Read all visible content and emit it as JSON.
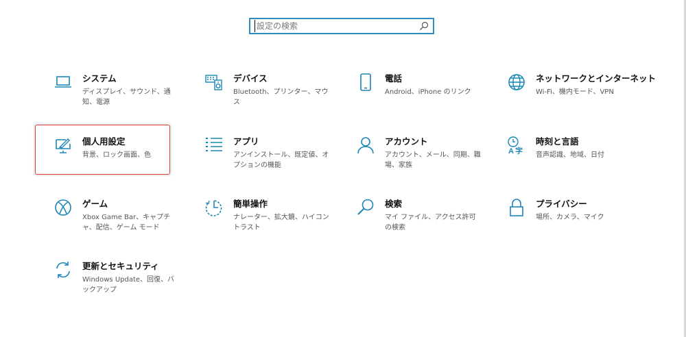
{
  "search": {
    "placeholder": "設定の検索"
  },
  "colors": {
    "accent": "#1a86b8",
    "highlight": "#e0413a"
  },
  "tiles": [
    {
      "title": "システム",
      "desc": "ディスプレイ、サウンド、通知、電源",
      "icon": "laptop-icon"
    },
    {
      "title": "デバイス",
      "desc": "Bluetooth、プリンター、マウス",
      "icon": "keyboard-speaker-icon"
    },
    {
      "title": "電話",
      "desc": "Android、iPhone のリンク",
      "icon": "phone-icon"
    },
    {
      "title": "ネットワークとインターネット",
      "desc": "Wi-Fi、機内モード、VPN",
      "icon": "globe-icon"
    },
    {
      "title": "個人用設定",
      "desc": "背景、ロック画面、色",
      "icon": "paint-monitor-icon"
    },
    {
      "title": "アプリ",
      "desc": "アンインストール、既定値、オプションの機能",
      "icon": "app-list-icon"
    },
    {
      "title": "アカウント",
      "desc": "アカウント、メール、同期、職場、家族",
      "icon": "person-icon"
    },
    {
      "title": "時刻と言語",
      "desc": "音声認識、地域、日付",
      "icon": "time-language-icon"
    },
    {
      "title": "ゲーム",
      "desc": "Xbox Game Bar、キャプチャ、配信、ゲーム モード",
      "icon": "xbox-icon"
    },
    {
      "title": "簡単操作",
      "desc": "ナレーター、拡大鏡、ハイコントラスト",
      "icon": "ease-of-access-icon"
    },
    {
      "title": "検索",
      "desc": "マイ ファイル、アクセス許可の検索",
      "icon": "search-magnifier-icon"
    },
    {
      "title": "プライバシー",
      "desc": "場所、カメラ、マイク",
      "icon": "lock-icon"
    },
    {
      "title": "更新とセキュリティ",
      "desc": "Windows Update、回復、バックアップ",
      "icon": "sync-icon"
    }
  ]
}
